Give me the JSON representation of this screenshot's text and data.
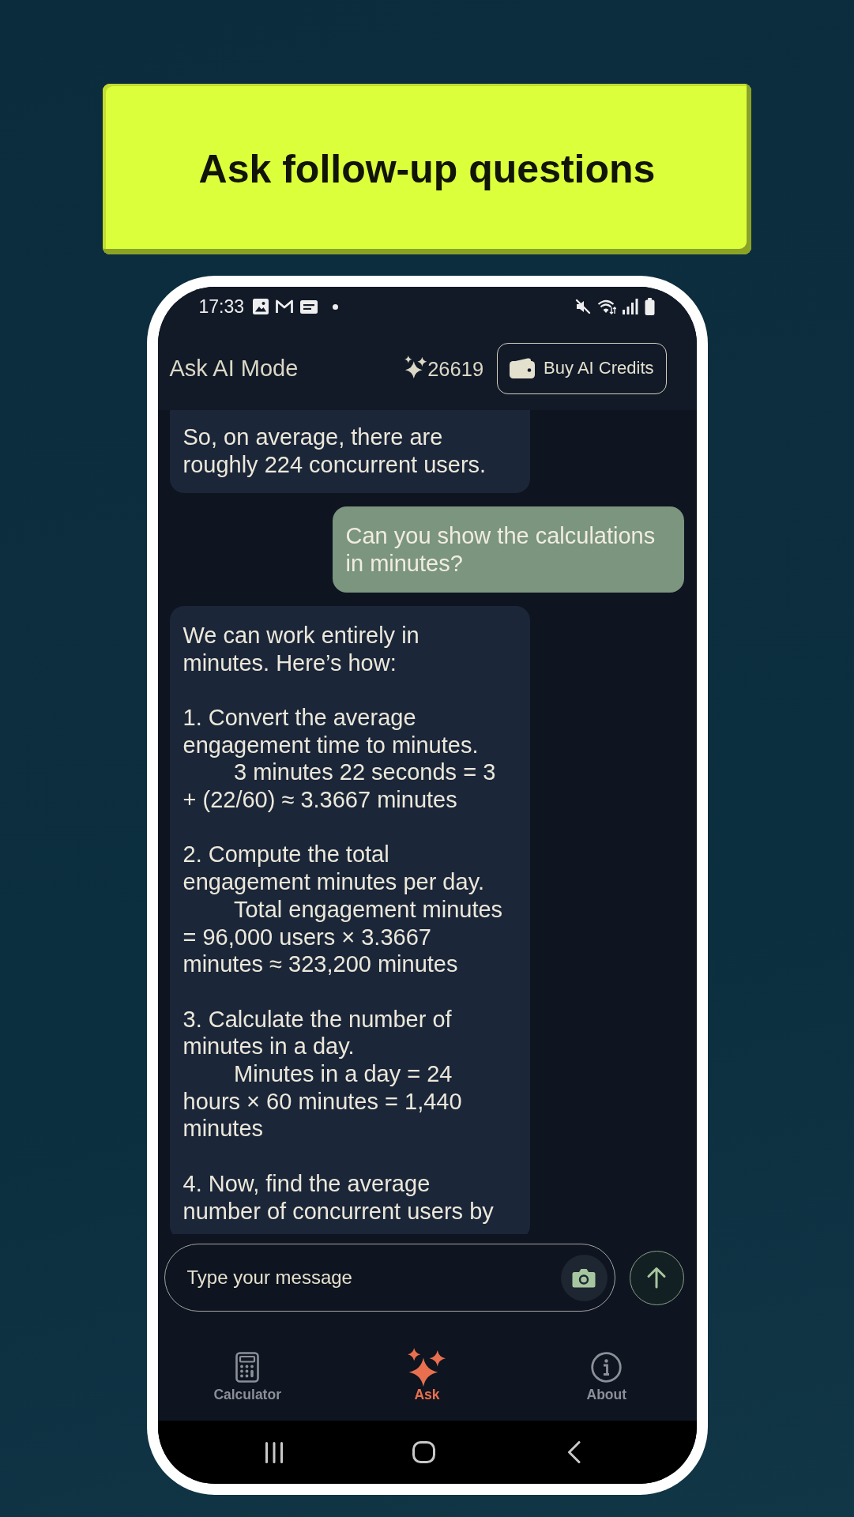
{
  "banner": {
    "title": "Ask follow-up questions"
  },
  "status_bar": {
    "time": "17:33"
  },
  "header": {
    "title": "Ask AI Mode",
    "credits": "26619",
    "buy_button": "Buy AI Credits"
  },
  "messages": [
    {
      "kind": "assistant",
      "text": "So, on average, there are roughly 224 concurrent users."
    },
    {
      "kind": "user",
      "text": "Can you show the calculations in minutes?"
    },
    {
      "kind": "assistant",
      "text": "We can work entirely in minutes. Here’s how:\n\n1. Convert the average engagement time to minutes.\n\t3 minutes 22 seconds = 3 + (22/60) ≈ 3.3667 minutes\n\n2. Compute the total engagement minutes per day.\n\tTotal engagement minutes = 96,000 users × 3.3667 minutes ≈ 323,200 minutes\n\n3. Calculate the number of minutes in a day.\n\tMinutes in a day = 24 hours × 60 minutes = 1,440 minutes\n\n4. Now, find the average number of concurrent users by"
    }
  ],
  "composer": {
    "placeholder": "Type your message"
  },
  "nav": [
    {
      "label": "Calculator",
      "selected": false
    },
    {
      "label": "Ask",
      "selected": true
    },
    {
      "label": "About",
      "selected": false
    }
  ]
}
